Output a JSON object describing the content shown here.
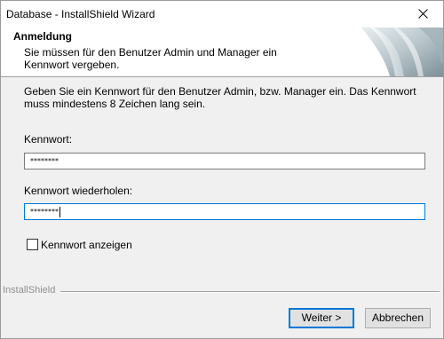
{
  "window": {
    "title": "Database - InstallShield Wizard",
    "close_glyph": "✕"
  },
  "header": {
    "title": "Anmeldung",
    "description": "Sie müssen für den Benutzer Admin und Manager ein Kennwort vergeben."
  },
  "main": {
    "instructions": "Geben Sie ein Kennwort für den Benutzer Admin, bzw. Manager ein. Das Kennwort muss mindestens 8 Zeichen lang sein.",
    "password_label": "Kennwort:",
    "password_value": "********",
    "confirm_label": "Kennwort wiederholen:",
    "confirm_value": "********",
    "show_password_label": "Kennwort anzeigen",
    "show_password_checked": false
  },
  "footer": {
    "brand": "InstallShield",
    "next_label": "Weiter >",
    "cancel_label": "Abbrechen"
  },
  "colors": {
    "focus_border": "#0078d7",
    "dialog_bg": "#f0f0f0"
  }
}
